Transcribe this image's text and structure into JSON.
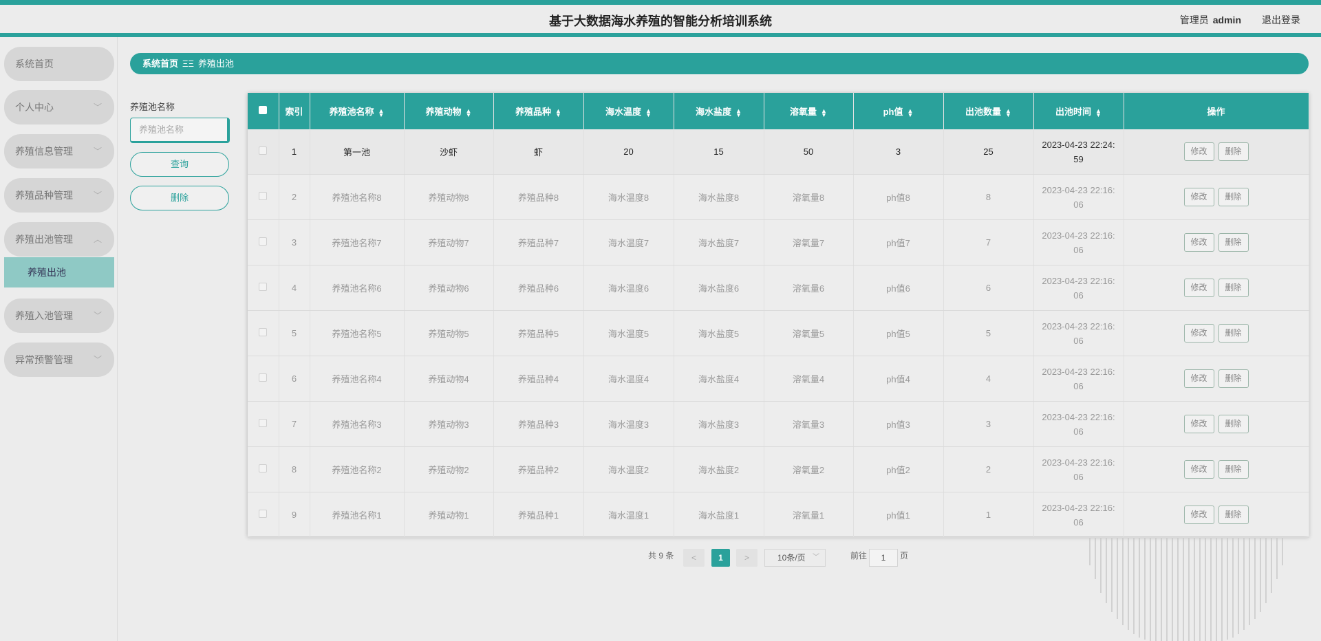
{
  "header": {
    "title": "基于大数据海水养殖的智能分析培训系统",
    "user_role": "管理员",
    "user_name": "admin",
    "logout": "退出登录"
  },
  "sidebar": {
    "items": [
      {
        "label": "系统首页"
      },
      {
        "label": "个人中心",
        "arrow": "﹀"
      },
      {
        "label": "养殖信息管理",
        "arrow": "﹀"
      },
      {
        "label": "养殖品种管理",
        "arrow": "﹀"
      },
      {
        "label": "养殖出池管理",
        "arrow": "︿"
      },
      {
        "label": "养殖入池管理",
        "arrow": "﹀"
      },
      {
        "label": "异常预警管理",
        "arrow": "﹀"
      }
    ],
    "active_sub": "养殖出池"
  },
  "breadcrumb": {
    "home": "系统首页",
    "sep": "ΞΞ",
    "current": "养殖出池"
  },
  "filter": {
    "label": "养殖池名称",
    "placeholder": "养殖池名称",
    "query": "查询",
    "delete": "删除"
  },
  "table": {
    "headers": [
      "索引",
      "养殖池名称",
      "养殖动物",
      "养殖品种",
      "海水温度",
      "海水盐度",
      "溶氧量",
      "ph值",
      "出池数量",
      "出池时间",
      "操作"
    ],
    "edit": "修改",
    "remove": "删除",
    "rows": [
      [
        "1",
        "第一池",
        "沙虾",
        "虾",
        "20",
        "15",
        "50",
        "3",
        "25",
        "2023-04-23 22:24:",
        "59"
      ],
      [
        "2",
        "养殖池名称8",
        "养殖动物8",
        "养殖品种8",
        "海水温度8",
        "海水盐度8",
        "溶氧量8",
        "ph值8",
        "8",
        "2023-04-23 22:16:",
        "06"
      ],
      [
        "3",
        "养殖池名称7",
        "养殖动物7",
        "养殖品种7",
        "海水温度7",
        "海水盐度7",
        "溶氧量7",
        "ph值7",
        "7",
        "2023-04-23 22:16:",
        "06"
      ],
      [
        "4",
        "养殖池名称6",
        "养殖动物6",
        "养殖品种6",
        "海水温度6",
        "海水盐度6",
        "溶氧量6",
        "ph值6",
        "6",
        "2023-04-23 22:16:",
        "06"
      ],
      [
        "5",
        "养殖池名称5",
        "养殖动物5",
        "养殖品种5",
        "海水温度5",
        "海水盐度5",
        "溶氧量5",
        "ph值5",
        "5",
        "2023-04-23 22:16:",
        "06"
      ],
      [
        "6",
        "养殖池名称4",
        "养殖动物4",
        "养殖品种4",
        "海水温度4",
        "海水盐度4",
        "溶氧量4",
        "ph值4",
        "4",
        "2023-04-23 22:16:",
        "06"
      ],
      [
        "7",
        "养殖池名称3",
        "养殖动物3",
        "养殖品种3",
        "海水温度3",
        "海水盐度3",
        "溶氧量3",
        "ph值3",
        "3",
        "2023-04-23 22:16:",
        "06"
      ],
      [
        "8",
        "养殖池名称2",
        "养殖动物2",
        "养殖品种2",
        "海水温度2",
        "海水盐度2",
        "溶氧量2",
        "ph值2",
        "2",
        "2023-04-23 22:16:",
        "06"
      ],
      [
        "9",
        "养殖池名称1",
        "养殖动物1",
        "养殖品种1",
        "海水温度1",
        "海水盐度1",
        "溶氧量1",
        "ph值1",
        "1",
        "2023-04-23 22:16:",
        "06"
      ]
    ]
  },
  "pagination": {
    "total": "共 9 条",
    "prev": "<",
    "page": "1",
    "next": ">",
    "size": "10条/页",
    "goto_prefix": "前往",
    "goto_value": "1",
    "goto_suffix": "页"
  },
  "colors": {
    "accent": "#2aa19b",
    "active_sub_bg": "#8fc9c5"
  }
}
